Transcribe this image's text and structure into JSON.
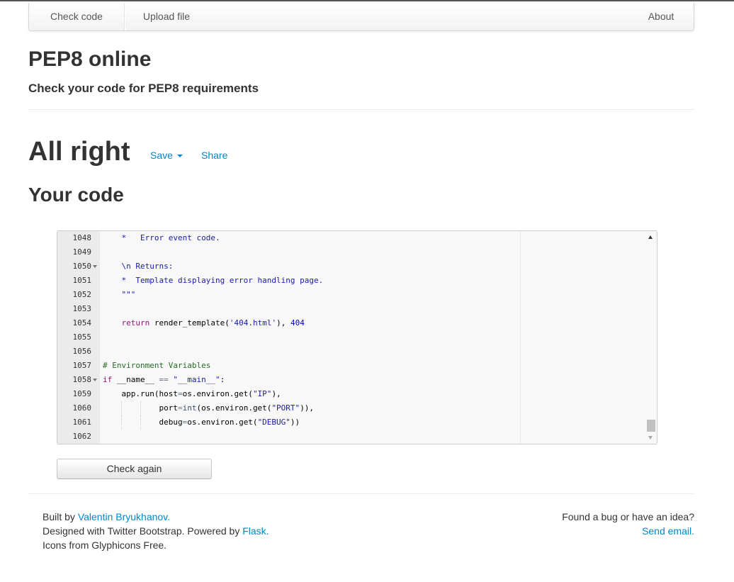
{
  "nav": {
    "check_code": "Check code",
    "upload_file": "Upload file",
    "about": "About"
  },
  "header": {
    "title": "PEP8 online",
    "subtitle": "Check your code for PEP8 requirements"
  },
  "result": {
    "status": "All right",
    "save_label": "Save",
    "share_label": "Share"
  },
  "code_section": {
    "title": "Your code",
    "lines": [
      {
        "number": "1048",
        "text": "    *   Error event code."
      },
      {
        "number": "1049",
        "text": ""
      },
      {
        "number": "1050",
        "text": "    \\n Returns:"
      },
      {
        "number": "1051",
        "text": "    *  Template displaying error handling page."
      },
      {
        "number": "1052",
        "text": "    \"\"\""
      },
      {
        "number": "1053",
        "text": ""
      },
      {
        "number": "1054",
        "text": "    return render_template('404.html'), 404"
      },
      {
        "number": "1055",
        "text": ""
      },
      {
        "number": "1056",
        "text": ""
      },
      {
        "number": "1057",
        "text": "# Environment Variables"
      },
      {
        "number": "1058",
        "text": "if __name__ == \"__main__\":"
      },
      {
        "number": "1059",
        "text": "    app.run(host=os.environ.get(\"IP\"),"
      },
      {
        "number": "1060",
        "text": "            port=int(os.environ.get(\"PORT\")),"
      },
      {
        "number": "1061",
        "text": "            debug=os.environ.get(\"DEBUG\"))"
      },
      {
        "number": "1062",
        "text": ""
      }
    ]
  },
  "check_again_label": "Check again",
  "footer": {
    "built_by": "Built by ",
    "author": "Valentin Bryukhanov.",
    "designed_with": "Designed with Twitter Bootstrap. Powered by ",
    "flask": "Flask.",
    "icons_credit": "Icons from Glyphicons Free.",
    "bug_prompt": "Found a bug or have an idea?",
    "send_email": "Send email."
  },
  "colors": {
    "link": "#0088cc",
    "text": "#333333",
    "keyword": "#93127f",
    "comment": "#236e24",
    "string": "#1a1aa6",
    "number": "#0000cd"
  }
}
